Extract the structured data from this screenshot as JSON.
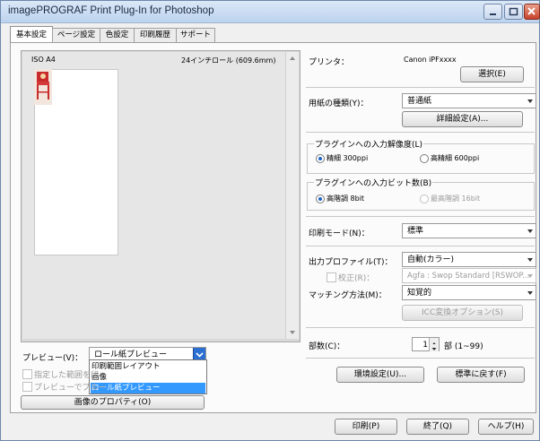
{
  "window": {
    "title": "imagePROGRAF Print Plug-In for Photoshop"
  },
  "tabs": [
    "基本設定",
    "ページ設定",
    "色設定",
    "印刷履歴",
    "サポート"
  ],
  "preview": {
    "paper_label": "ISO A4",
    "roll_label": "24インチロール (609.6mm)"
  },
  "left": {
    "preview_label": "プレビュー(V)：",
    "preview_value": "ロール紙プレビュー",
    "preview_options": [
      "印刷範囲レイアウト",
      "画像",
      "ロール紙プレビュー"
    ],
    "check1_label": "指定した範囲を印",
    "check2_label": "プレビューでプルー",
    "image_props_button": "画像のプロパティ(O)"
  },
  "right": {
    "printer_label": "プリンタ：",
    "printer_value": "Canon iPFxxxx",
    "select_button": "選択(E)",
    "media_label": "用紙の種類(Y)：",
    "media_value": "普通紙",
    "detail_button": "詳細設定(A)...",
    "resolution_group": "プラグインへの入力解像度(L)",
    "res_opt1": "精細 300ppi",
    "res_opt2": "高精細 600ppi",
    "bit_group": "プラグインへの入力ビット数(B)",
    "bit_opt1": "高階調 8bit",
    "bit_opt2": "最高階調 16bit",
    "print_mode_label": "印刷モード(N)：",
    "print_mode_value": "標準",
    "output_profile_label": "出力プロファイル(T)：",
    "output_profile_value": "自動(カラー)",
    "proof_label": "校正(R)：",
    "proof_value": "Agfa : Swop Standard [RSWOP...",
    "matching_label": "マッチング方法(M)：",
    "matching_value": "知覚的",
    "icc_button": "ICC変換オプション(S)",
    "copies_label": "部数(C)：",
    "copies_value": "1",
    "copies_unit": "部 (1~99)",
    "env_button": "環境設定(U)...",
    "standard_button": "標準に戻す(F)"
  },
  "footer": {
    "print_button": "印刷(P)",
    "exit_button": "終了(Q)",
    "help_button": "ヘルプ(H)"
  },
  "icons": [
    "minimize-icon",
    "maximize-icon",
    "close-icon",
    "chair-thumbnail-icon"
  ]
}
